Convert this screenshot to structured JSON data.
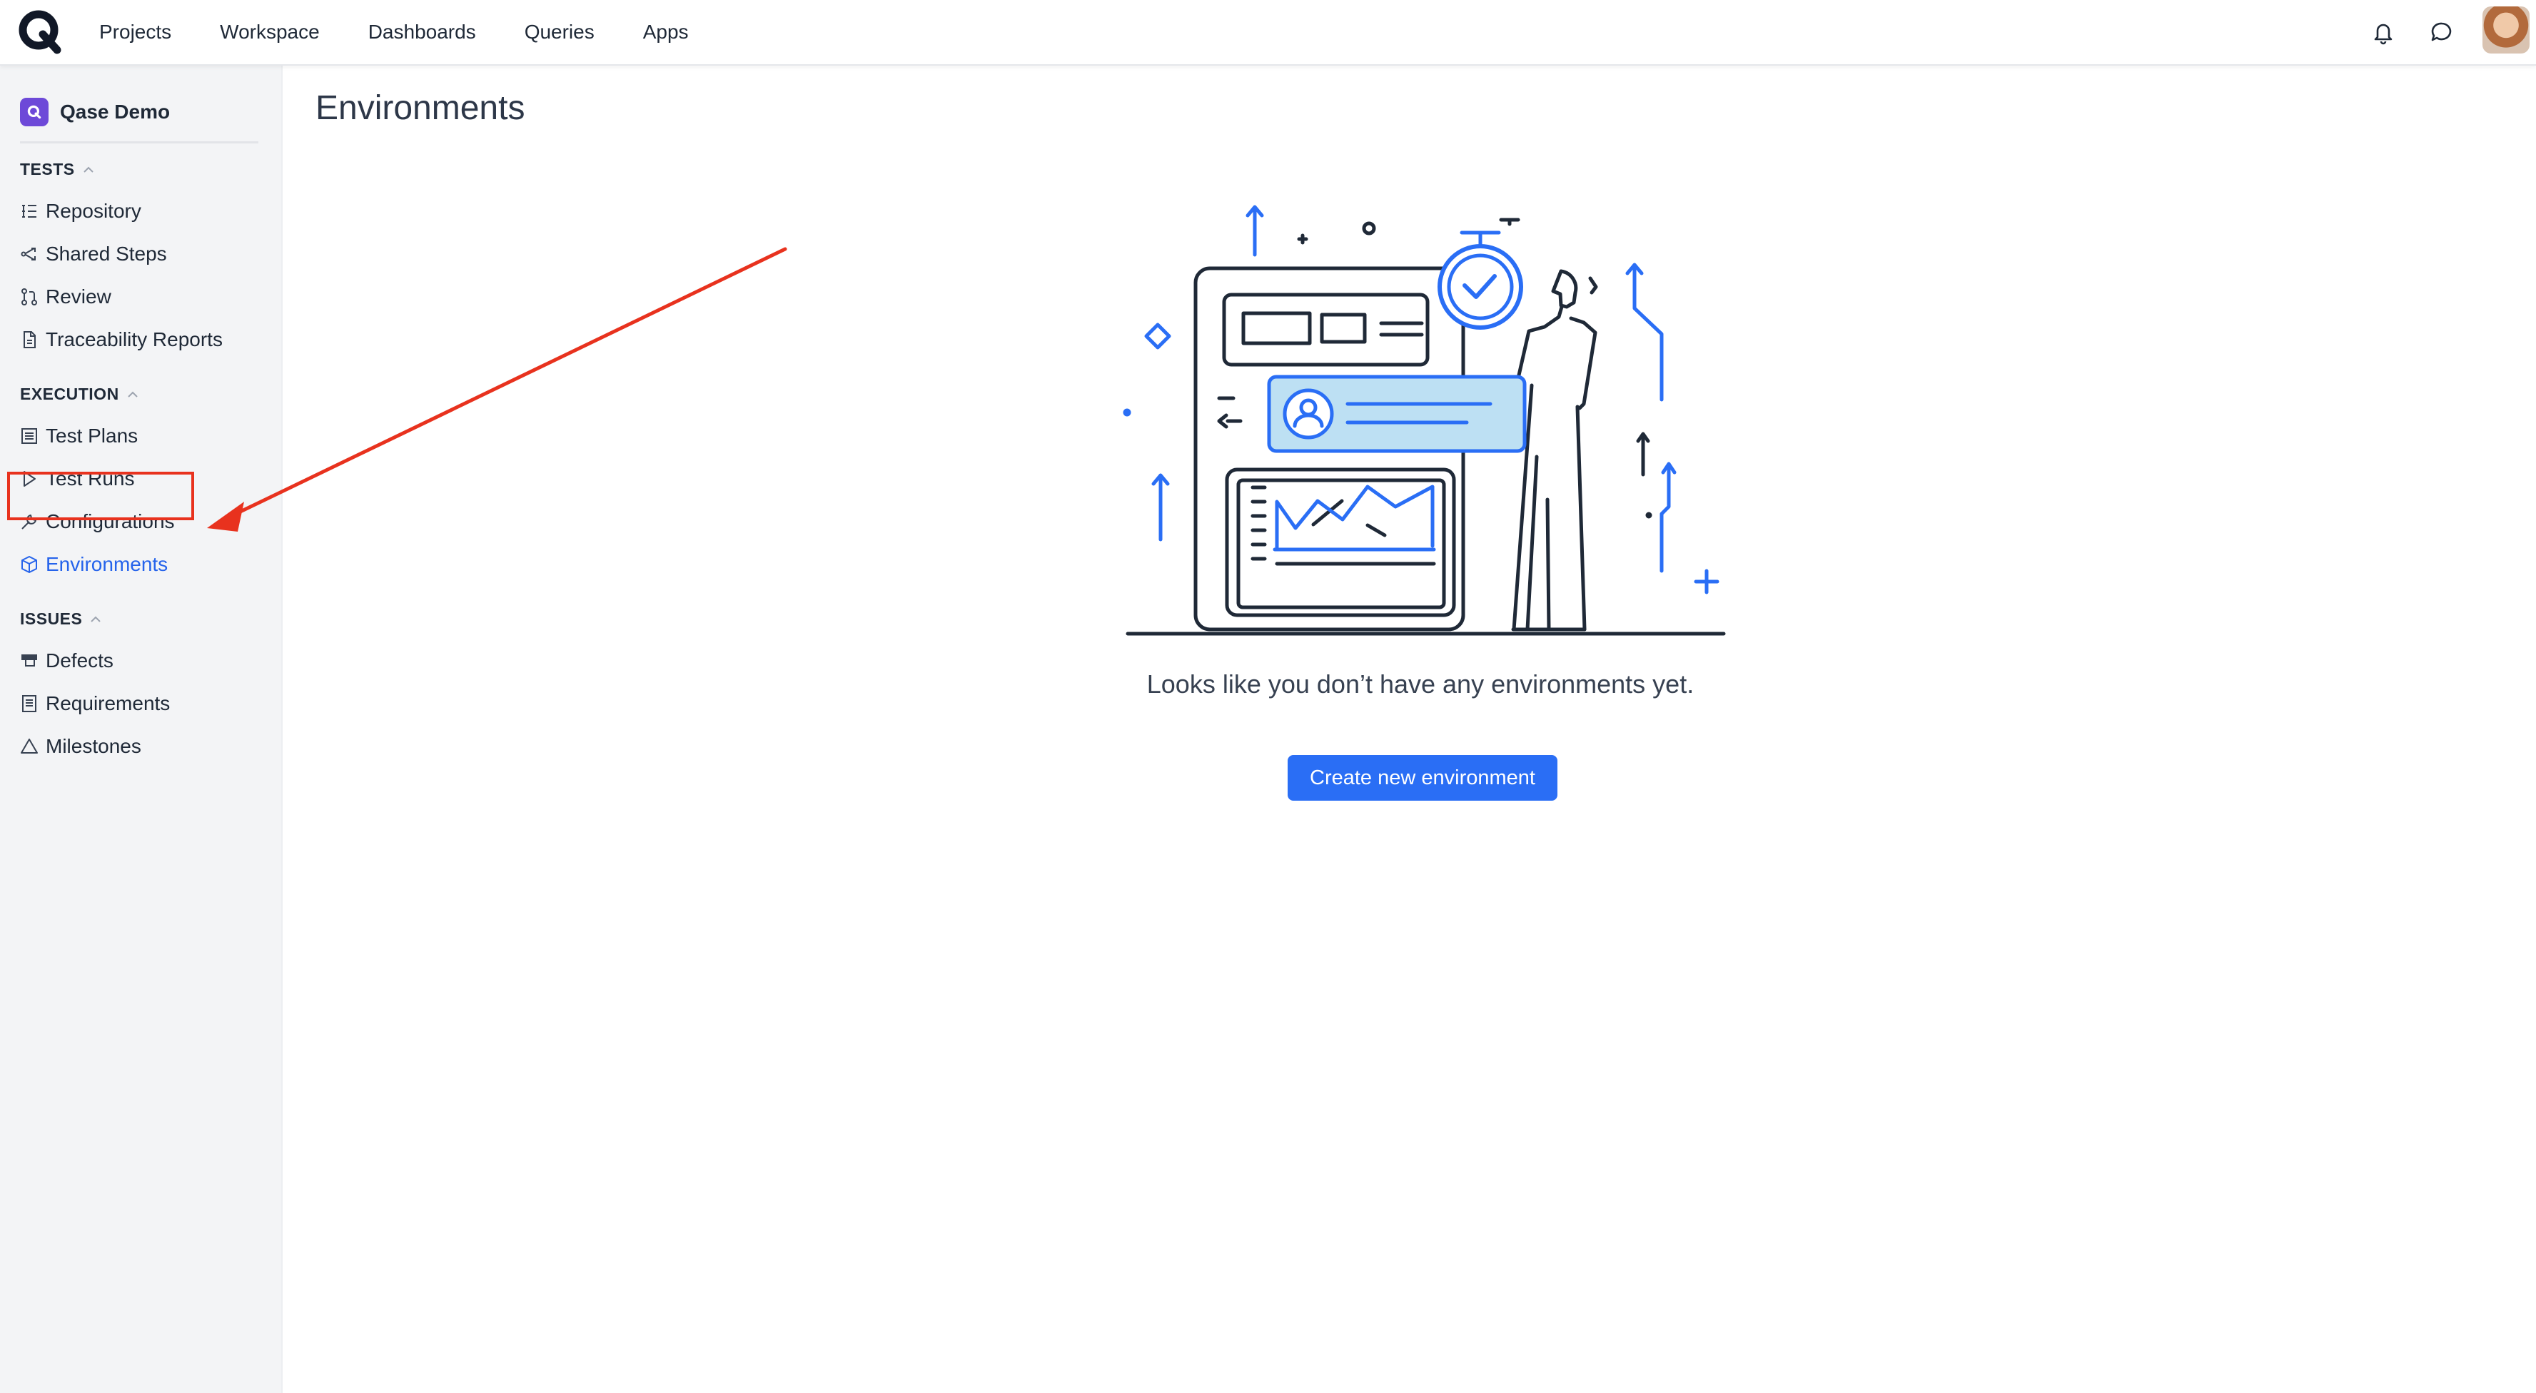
{
  "topnav": {
    "items": [
      "Projects",
      "Workspace",
      "Dashboards",
      "Queries",
      "Apps"
    ]
  },
  "topicons": [
    "notification-bell-icon",
    "chat-icon",
    "user-avatar"
  ],
  "sidebar": {
    "project_name": "Qase Demo",
    "sections": [
      {
        "title": "TESTS",
        "items": [
          {
            "label": "Repository",
            "icon": "repository-icon"
          },
          {
            "label": "Shared Steps",
            "icon": "shared-steps-icon"
          },
          {
            "label": "Review",
            "icon": "review-icon"
          },
          {
            "label": "Traceability Reports",
            "icon": "report-icon"
          }
        ]
      },
      {
        "title": "EXECUTION",
        "items": [
          {
            "label": "Test Plans",
            "icon": "test-plans-icon"
          },
          {
            "label": "Test Runs",
            "icon": "play-icon"
          },
          {
            "label": "Configurations",
            "icon": "wrench-icon"
          },
          {
            "label": "Environments",
            "icon": "cube-icon",
            "active": true
          }
        ]
      },
      {
        "title": "ISSUES",
        "items": [
          {
            "label": "Defects",
            "icon": "defects-icon"
          },
          {
            "label": "Requirements",
            "icon": "requirements-icon"
          },
          {
            "label": "Milestones",
            "icon": "milestone-icon"
          }
        ]
      }
    ]
  },
  "main": {
    "title": "Environments",
    "empty_message": "Looks like you don’t have any environments yet.",
    "create_button": "Create new environment"
  },
  "colors": {
    "accent": "#2a6ef5",
    "active_link": "#2563eb",
    "annotation": "#e8321e",
    "brand_purple": "#6d49d8"
  }
}
